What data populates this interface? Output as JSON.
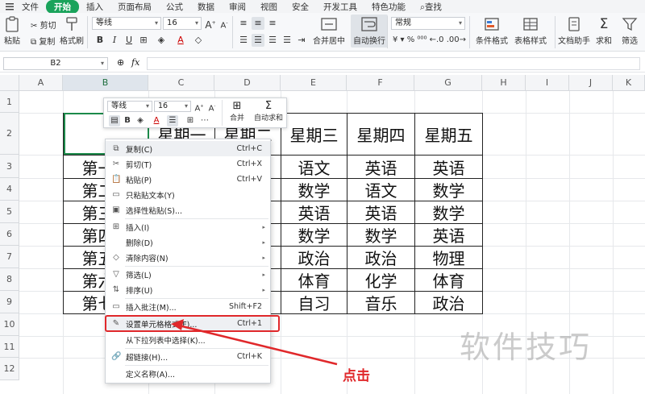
{
  "menubar": {
    "items": [
      "文件",
      "开始",
      "插入",
      "页面布局",
      "公式",
      "数据",
      "审阅",
      "视图",
      "安全",
      "开发工具",
      "特色功能",
      "查找"
    ],
    "active": "开始"
  },
  "ribbon": {
    "cut": "剪切",
    "paste": "粘贴",
    "copy": "复制",
    "format_painter": "格式刷",
    "font_name": "等线",
    "font_size": "16",
    "merge_center": "合并居中",
    "wrap_text": "自动换行",
    "number_format": "常规",
    "cond_format": "条件格式",
    "table_style": "表格样式",
    "doc_helper": "文档助手",
    "sum": "求和",
    "filter": "筛选"
  },
  "formula_bar": {
    "name_box": "B2",
    "fx": "fx",
    "value": ""
  },
  "grid": {
    "columns": [
      "A",
      "B",
      "C",
      "D",
      "E",
      "F",
      "G",
      "H",
      "I",
      "J",
      "K"
    ],
    "rows": [
      "1",
      "2",
      "3",
      "4",
      "5",
      "6",
      "7",
      "8",
      "9",
      "10",
      "11",
      "12"
    ],
    "selected_col": "B"
  },
  "table": {
    "headers": [
      "",
      "星期一",
      "星期二",
      "星期三",
      "星期四",
      "星期五"
    ],
    "row_labels": [
      "第一节",
      "第二节",
      "第三节",
      "第四节",
      "第五节",
      "第六节",
      "第七节"
    ],
    "cols_e": [
      "语文",
      "数学",
      "英语",
      "数学",
      "政治",
      "体育",
      "自习"
    ],
    "cols_f": [
      "英语",
      "语文",
      "英语",
      "数学",
      "政治",
      "化学",
      "音乐"
    ],
    "cols_g": [
      "英语",
      "数学",
      "数学",
      "英语",
      "物理",
      "体育",
      "政治"
    ]
  },
  "mini_toolbar": {
    "font_name": "等线",
    "font_size": "16",
    "merge": "合并",
    "autosum": "自动求和"
  },
  "context_menu": {
    "items": [
      {
        "icon": "copy-icon",
        "label": "复制(C)",
        "shortcut": "Ctrl+C",
        "arrow": false
      },
      {
        "icon": "cut-icon",
        "label": "剪切(T)",
        "shortcut": "Ctrl+X",
        "arrow": false
      },
      {
        "icon": "paste-icon",
        "label": "粘贴(P)",
        "shortcut": "Ctrl+V",
        "arrow": false
      },
      {
        "icon": "paste-text-icon",
        "label": "只粘贴文本(Y)",
        "shortcut": "",
        "arrow": false
      },
      {
        "icon": "paste-special-icon",
        "label": "选择性粘贴(S)...",
        "shortcut": "",
        "arrow": false
      },
      {
        "icon": "insert-icon",
        "label": "插入(I)",
        "shortcut": "",
        "arrow": true
      },
      {
        "icon": "",
        "label": "删除(D)",
        "shortcut": "",
        "arrow": true
      },
      {
        "icon": "eraser-icon",
        "label": "清除内容(N)",
        "shortcut": "",
        "arrow": true
      },
      {
        "icon": "filter-icon",
        "label": "筛选(L)",
        "shortcut": "",
        "arrow": true
      },
      {
        "icon": "sort-icon",
        "label": "排序(U)",
        "shortcut": "",
        "arrow": true
      },
      {
        "icon": "comment-icon",
        "label": "插入批注(M)...",
        "shortcut": "Shift+F2",
        "arrow": false
      },
      {
        "icon": "format-cells-icon",
        "label": "设置单元格格式(F)...",
        "shortcut": "Ctrl+1",
        "arrow": false
      },
      {
        "icon": "",
        "label": "从下拉列表中选择(K)...",
        "shortcut": "",
        "arrow": false
      },
      {
        "icon": "link-icon",
        "label": "超链接(H)...",
        "shortcut": "Ctrl+K",
        "arrow": false
      },
      {
        "icon": "",
        "label": "定义名称(A)...",
        "shortcut": "",
        "arrow": false
      }
    ]
  },
  "annotation": {
    "text": "点击",
    "color": "#e0282b"
  },
  "watermark": "软件技巧",
  "colors": {
    "accent": "#1aa35b",
    "selection": "#1c8a4a",
    "annotation": "#e0282b"
  }
}
